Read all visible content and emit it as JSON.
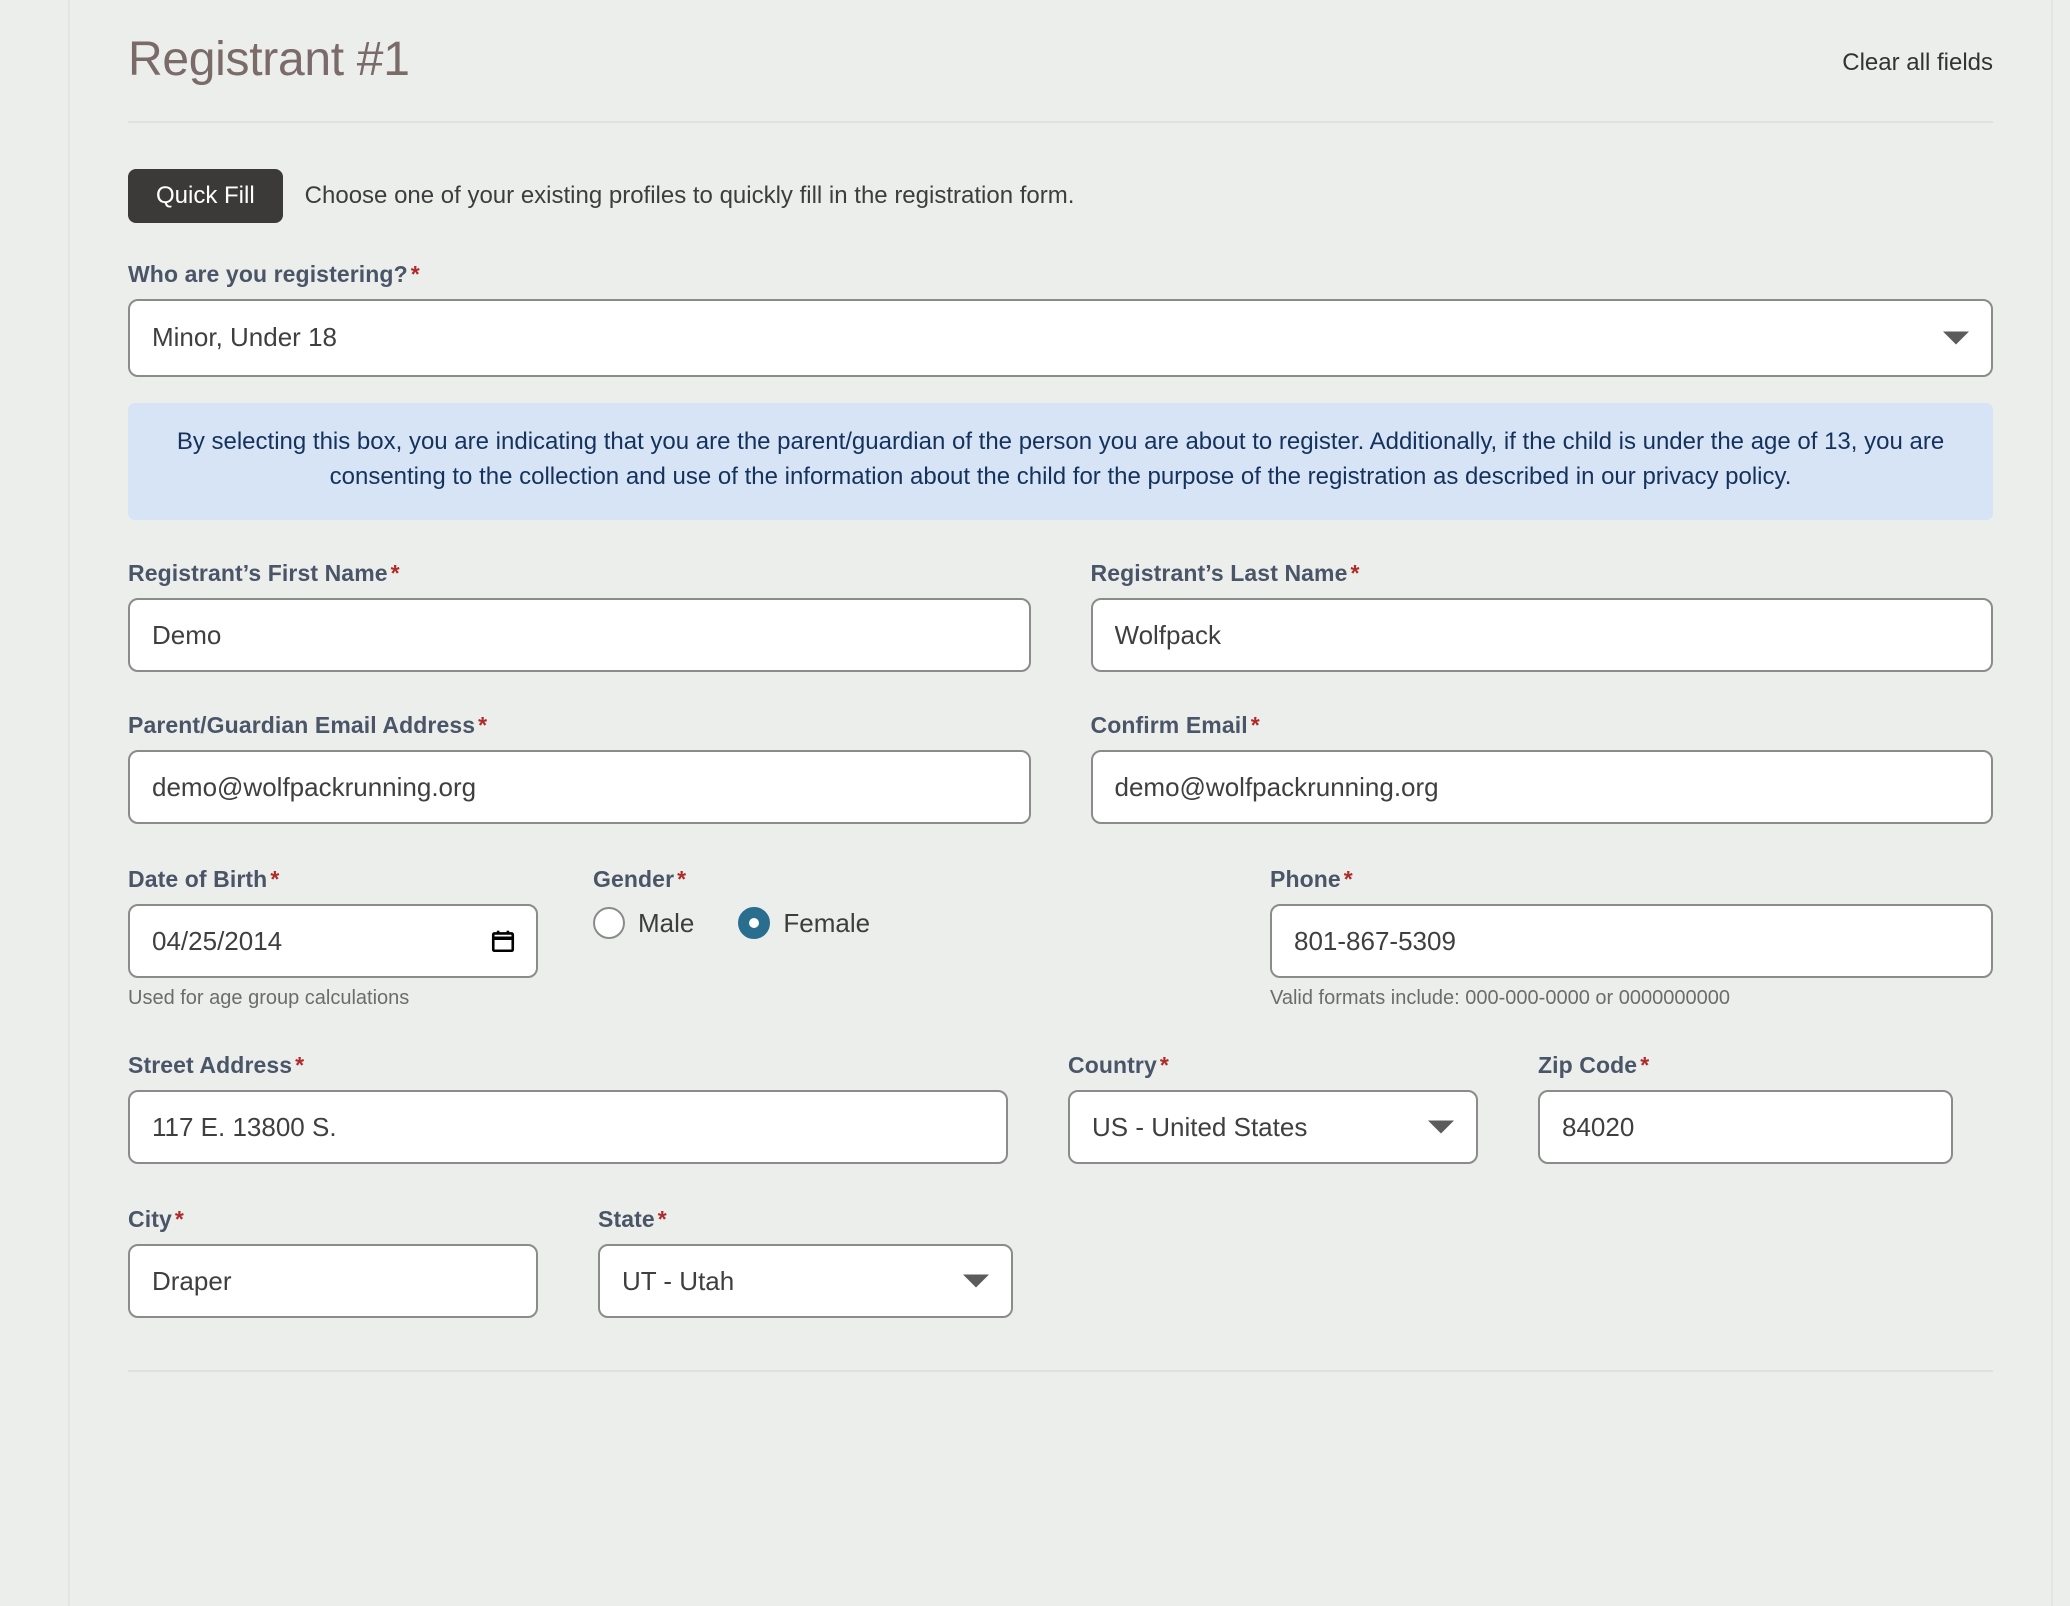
{
  "header": {
    "title": "Registrant #1",
    "clear_link": "Clear all fields"
  },
  "quick_fill": {
    "button_label": "Quick Fill",
    "note": "Choose one of your existing profiles to quickly fill in the registration form."
  },
  "who_registering": {
    "label": "Who are you registering?",
    "required_mark": "*",
    "value": "Minor, Under 18"
  },
  "notice": {
    "text": "By selecting this box, you are indicating that you are the parent/guardian of the person you are about to register. Additionally, if the child is under the age of 13, you are consenting to the collection and use of the information about the child for the purpose of the registration as described in our privacy policy."
  },
  "fields": {
    "first_name": {
      "label": "Registrant’s First Name",
      "value": "Demo",
      "required_mark": "*"
    },
    "last_name": {
      "label": "Registrant’s Last Name",
      "value": "Wolfpack",
      "required_mark": "*"
    },
    "email": {
      "label": "Parent/Guardian Email Address",
      "value": "demo@wolfpackrunning.org",
      "required_mark": "*"
    },
    "confirm_email": {
      "label": "Confirm Email",
      "value": "demo@wolfpackrunning.org",
      "required_mark": "*"
    },
    "dob": {
      "label": "Date of Birth",
      "value": "04/25/2014",
      "required_mark": "*",
      "help": "Used for age group calculations"
    },
    "gender": {
      "label": "Gender",
      "required_mark": "*",
      "options": [
        {
          "label": "Male",
          "selected": false
        },
        {
          "label": "Female",
          "selected": true
        }
      ]
    },
    "phone": {
      "label": "Phone",
      "value": "801-867-5309",
      "required_mark": "*",
      "help": "Valid formats include: 000-000-0000 or 0000000000"
    },
    "street": {
      "label": "Street Address",
      "value": "117 E. 13800 S.",
      "required_mark": "*"
    },
    "country": {
      "label": "Country",
      "value": "US - United States",
      "required_mark": "*"
    },
    "zip": {
      "label": "Zip Code",
      "value": "84020",
      "required_mark": "*"
    },
    "city": {
      "label": "City",
      "value": "Draper",
      "required_mark": "*"
    },
    "state": {
      "label": "State",
      "value": "UT - Utah",
      "required_mark": "*"
    }
  },
  "colors": {
    "page_background": "#eceeec",
    "label": "#4a5568",
    "required": "#b02a2a",
    "title": "#7a6a68",
    "button": "#3b3a38",
    "notice_background": "#d6e4f5",
    "notice_text": "#15325c",
    "radio_selected": "#2a6e8f",
    "input_border": "#8b8b8b"
  },
  "icons": {
    "calendar": "calendar-icon",
    "caret": "chevron-down-icon"
  }
}
